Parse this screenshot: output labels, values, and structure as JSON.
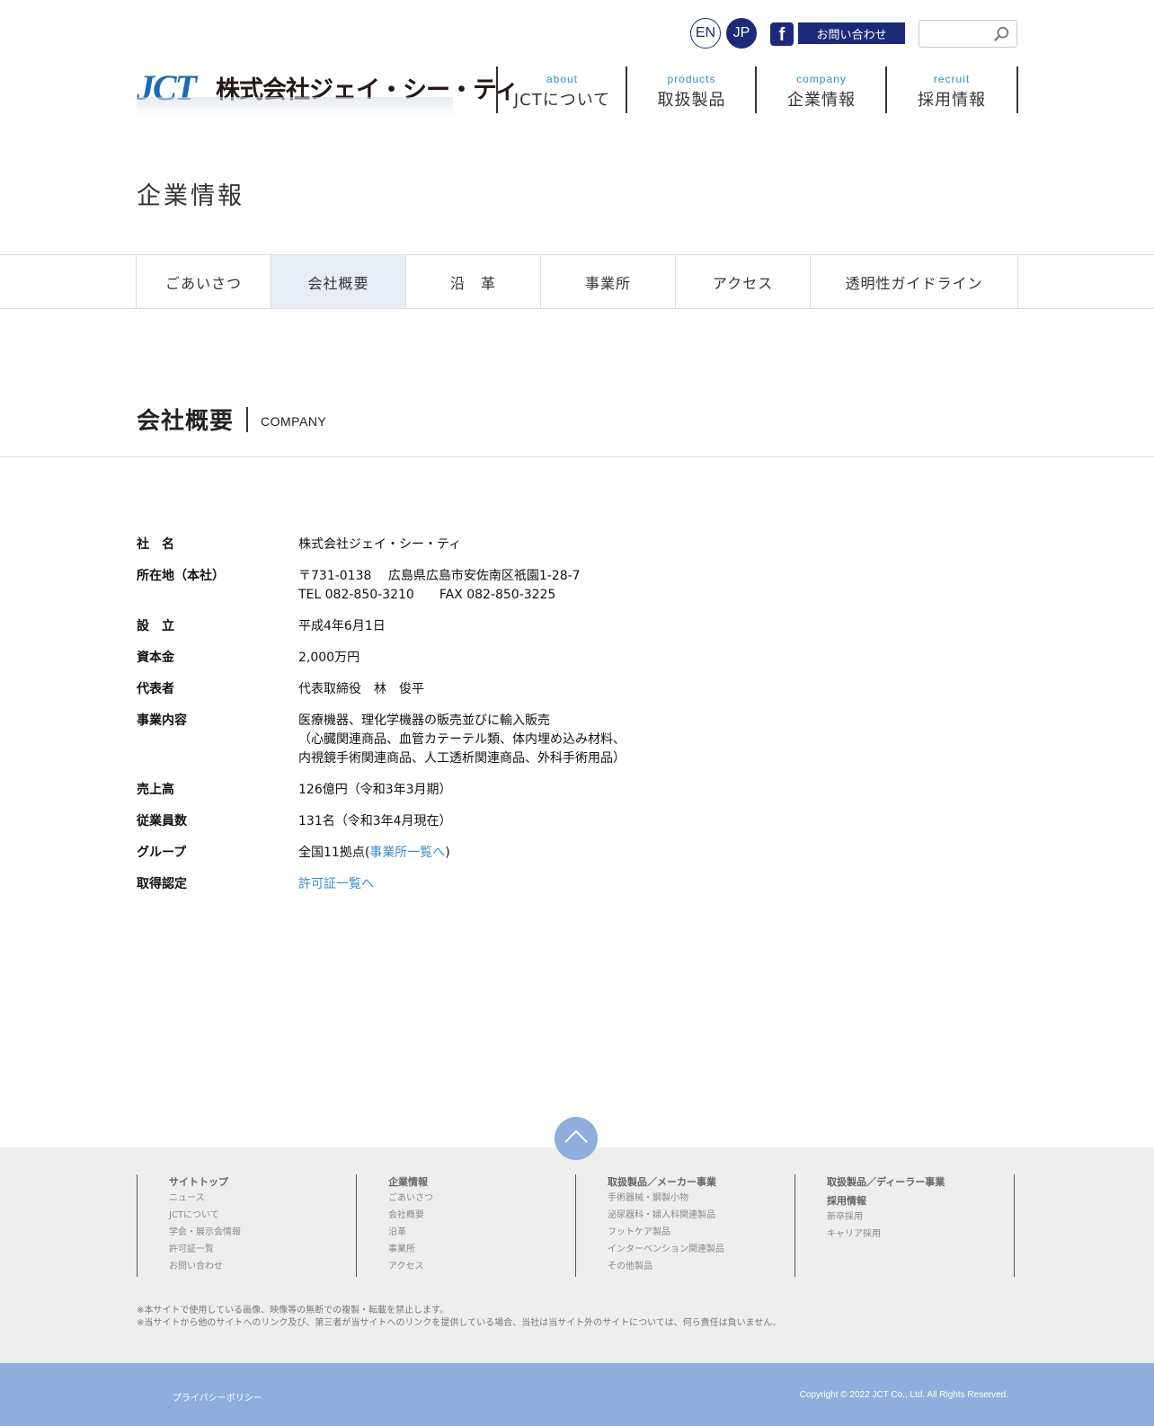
{
  "header": {
    "lang_en": "EN",
    "lang_jp": "JP",
    "facebook": "f",
    "contact_label": "お問い合わせ",
    "search_placeholder": "",
    "logo_mark": "JCT",
    "logo_name": "株式会社ジェイ・シー・ティ",
    "nav": [
      {
        "en": "about",
        "ja": "JCTについて"
      },
      {
        "en": "products",
        "ja": "取扱製品"
      },
      {
        "en": "company",
        "ja": "企業情報"
      },
      {
        "en": "recruit",
        "ja": "採用情報"
      }
    ]
  },
  "page_title": "企業情報",
  "subnav": [
    "ごあいさつ",
    "会社概要",
    "沿　革",
    "事業所",
    "アクセス",
    "透明性ガイドライン"
  ],
  "subnav_active": "会社概要",
  "section": {
    "title_ja": "会社概要",
    "title_en": "COMPANY"
  },
  "profile": [
    {
      "key": "社　名",
      "lines": [
        "株式会社ジェイ・シー・ティ"
      ]
    },
    {
      "key": "所在地（本社）",
      "lines": [
        "〒731-0138　 広島県広島市安佐南区祇園1-28-7",
        "TEL 082-850-3210　　FAX 082-850-3225"
      ]
    },
    {
      "key": "設　立",
      "lines": [
        "平成4年6月1日"
      ]
    },
    {
      "key": "資本金",
      "lines": [
        "2,000万円"
      ]
    },
    {
      "key": "代表者",
      "lines": [
        "代表取締役　林　俊平"
      ]
    },
    {
      "key": "事業内容",
      "lines": [
        "医療機器、理化学機器の販売並びに輸入販売",
        "（心臓関連商品、血管カテーテル類、体内埋め込み材料、",
        "内視鏡手術関連商品、人工透析関連商品、外科手術用品）"
      ]
    },
    {
      "key": "売上高",
      "lines": [
        "126億円（令和3年3月期）"
      ]
    },
    {
      "key": "従業員数",
      "lines": [
        "131名（令和3年4月現在）"
      ]
    },
    {
      "key": "グループ",
      "prefix": "全国11拠点(",
      "link": "事業所一覧へ",
      "suffix": ")"
    },
    {
      "key": "取得認定",
      "link": "許可証一覧へ"
    }
  ],
  "footer": {
    "columns": [
      {
        "heading": "サイトトップ",
        "links": [
          "ニュース",
          "JCTについて",
          "学会・展示会情報",
          "許可証一覧",
          "お問い合わせ"
        ]
      },
      {
        "heading": "企業情報",
        "links": [
          "ごあいさつ",
          "会社概要",
          "沿革",
          "事業所",
          "アクセス"
        ]
      },
      {
        "heading": "取扱製品／メーカー事業",
        "links": [
          "手術器械・鋼製小物",
          "泌尿器科・婦人科関連製品",
          "フットケア製品",
          "インターベンション関連製品",
          "その他製品"
        ]
      },
      {
        "heading": "取扱製品／ディーラー事業",
        "heading2": "採用情報",
        "links": [
          "新卒採用",
          "キャリア採用"
        ]
      }
    ],
    "notes": [
      "※本サイトで使用している画像、映像等の無断での複製・転載を禁止します。",
      "※当サイトから他のサイトへのリンク及び、第三者が当サイトへのリンクを提供している場合、当社は当サイト外のサイトについては、何ら責任は負いません。"
    ],
    "privacy": "プライバシーポリシー",
    "copyright": "Copyright © 2022 JCT Co., Ltd. All Rights Reserved."
  },
  "colors": {
    "brand_navy": "#1d2a7a",
    "accent_blue": "#2b8fc7",
    "link": "#3a8ccf",
    "footer_blue": "#8eaedb"
  }
}
